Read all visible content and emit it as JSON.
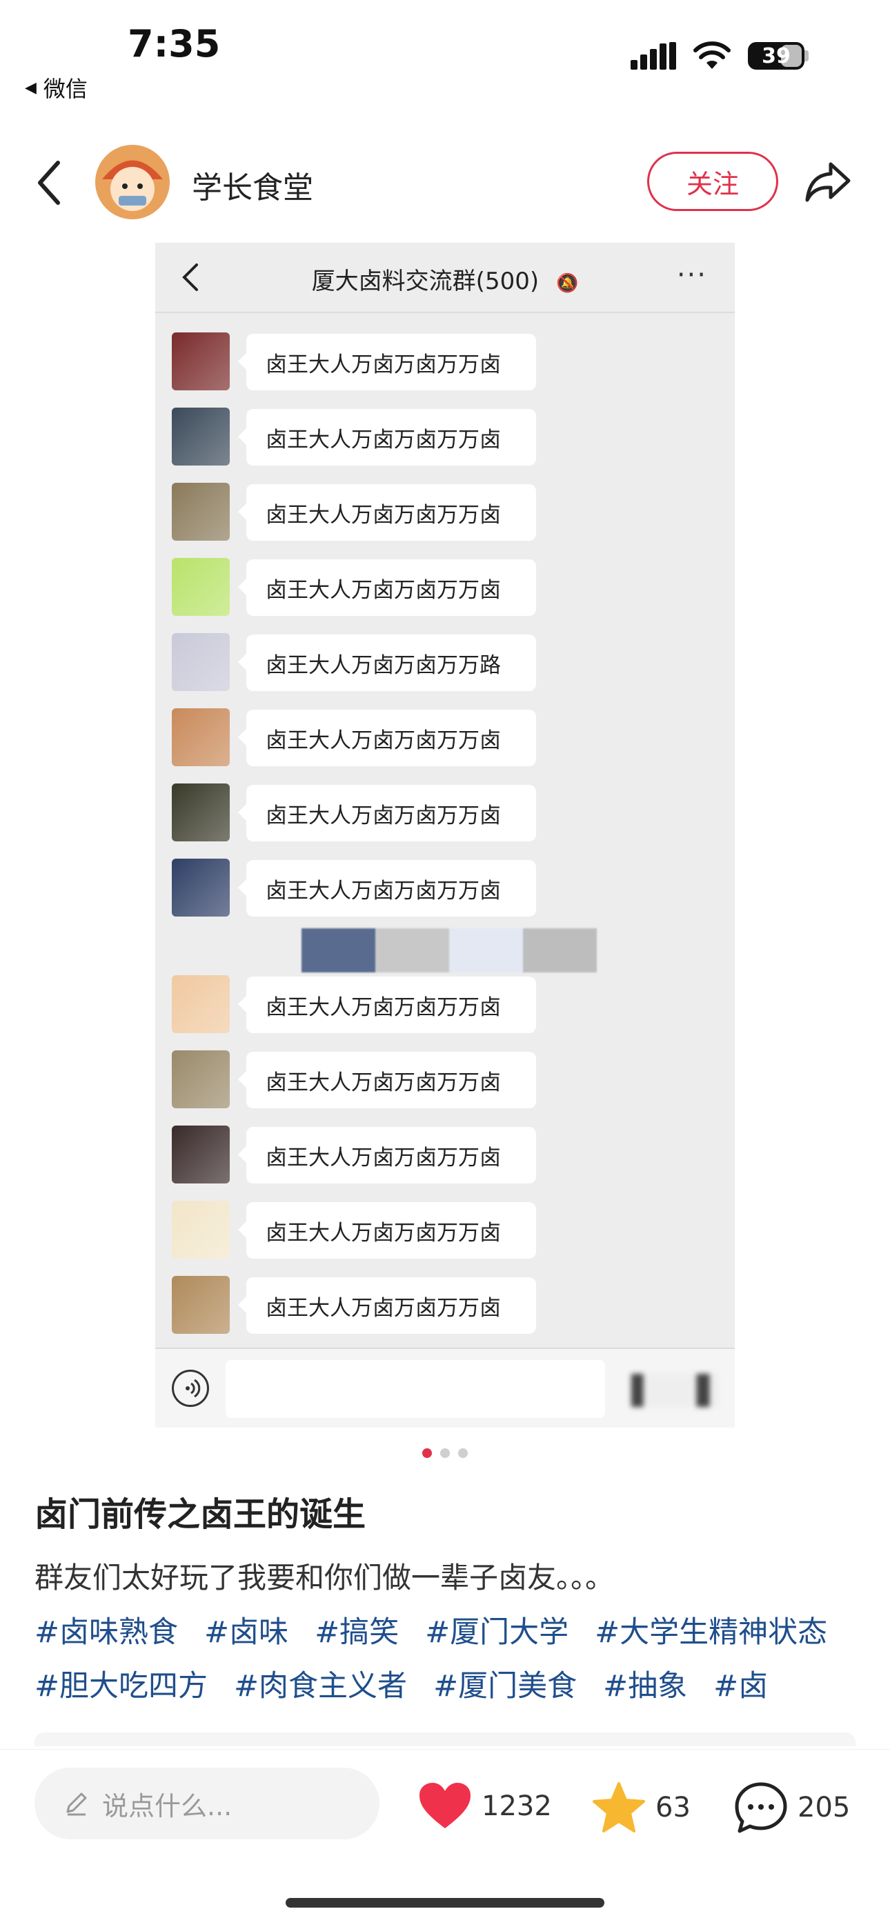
{
  "status_bar": {
    "time": "7:35",
    "back_app": "微信",
    "battery": "39"
  },
  "header": {
    "author": "学长食堂",
    "follow_label": "关注"
  },
  "chat_screenshot": {
    "title": "厦大卤料交流群(500)",
    "messages": [
      "卤王大人万卤万卤万万卤",
      "卤王大人万卤万卤万万卤",
      "卤王大人万卤万卤万万卤",
      "卤王大人万卤万卤万万卤",
      "卤王大人万卤万卤万万路",
      "卤王大人万卤万卤万万卤",
      "卤王大人万卤万卤万万卤",
      "卤王大人万卤万卤万万卤",
      "卤王大人万卤万卤万万卤",
      "卤王大人万卤万卤万万卤",
      "卤王大人万卤万卤万万卤",
      "卤王大人万卤万卤万万卤",
      "卤王大人万卤万卤万万卤"
    ],
    "avatar_colors": [
      "#7a2b2b",
      "#3b4a5a",
      "#8a7a5a",
      "#b9e36a",
      "#c9c9d9",
      "#c98a5a",
      "#3a3a2a",
      "#2f3f66",
      "#f0c9a0",
      "#9a8a6a",
      "#3a2a2a",
      "#f2e6c9",
      "#b08a5a"
    ]
  },
  "pager": {
    "count": 3,
    "active": 0
  },
  "post": {
    "title": "卤门前传之卤王的诞生",
    "body": "群友们太好玩了我要和你们做一辈子卤友。。。",
    "tags": [
      "#卤味熟食",
      "#卤味",
      "#搞笑",
      "#厦门大学",
      "#大学生精神状态",
      "#胆大吃四方",
      "#肉食主义者",
      "#厦门美食",
      "#抽象",
      "#卤"
    ]
  },
  "bottom_bar": {
    "comment_placeholder": "说点什么...",
    "likes": "1232",
    "collects": "63",
    "comments": "205"
  },
  "colors": {
    "accent": "#e0314b",
    "tag": "#1f4e8c",
    "star": "#f7b731"
  }
}
